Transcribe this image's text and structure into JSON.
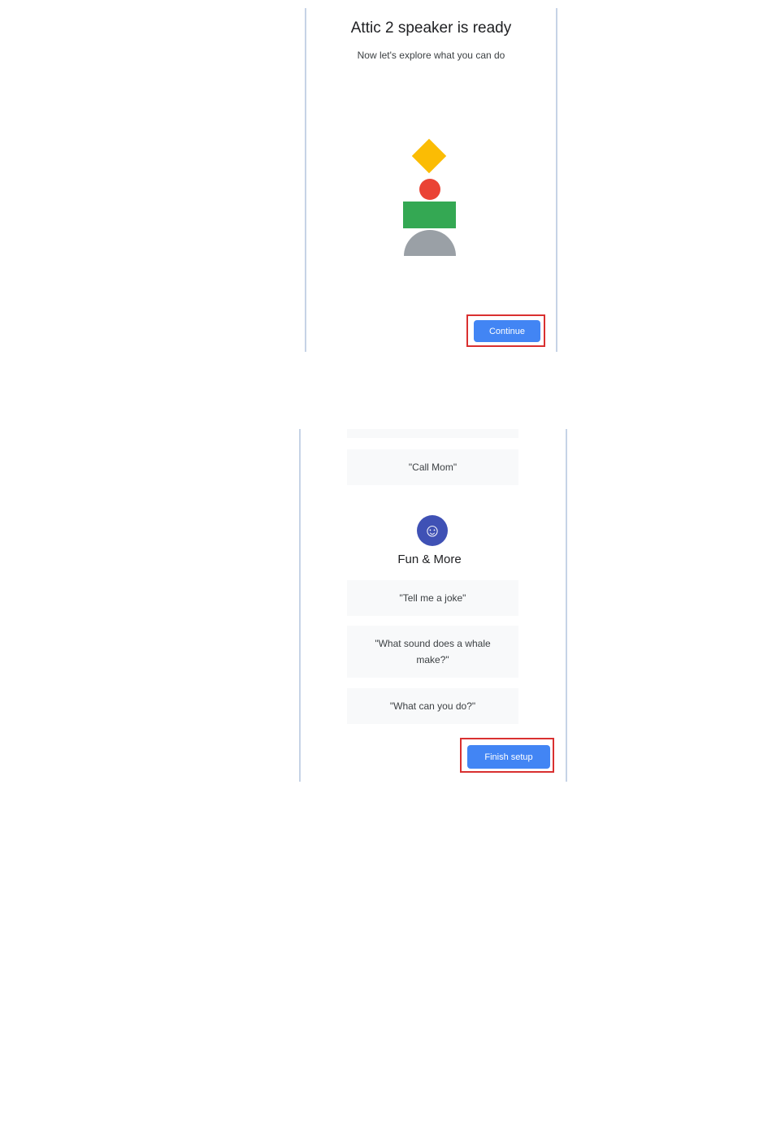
{
  "colors": {
    "primary_button": "#4285f4",
    "highlight": "#d93030",
    "card_bg": "#f8f9fa",
    "shape_yellow": "#fbbc04",
    "shape_red": "#ea4335",
    "shape_green": "#34a853",
    "shape_gray": "#9aa0a6",
    "fun_icon_bg": "#3f51b5"
  },
  "screen1": {
    "title": "Attic 2 speaker is ready",
    "subtitle": "Now let's explore what you can do",
    "continue_label": "Continue",
    "illustration_icon": "stacked-shapes-illustration"
  },
  "screen2": {
    "call_card": "\"Call Mom\"",
    "fun_icon": "smiley-face-icon",
    "fun_icon_glyph": "☺",
    "section_title": "Fun & More",
    "cards": [
      "\"Tell me a joke\"",
      "\"What sound does a whale make?\"",
      "\"What can you do?\""
    ],
    "finish_label": "Finish setup"
  }
}
